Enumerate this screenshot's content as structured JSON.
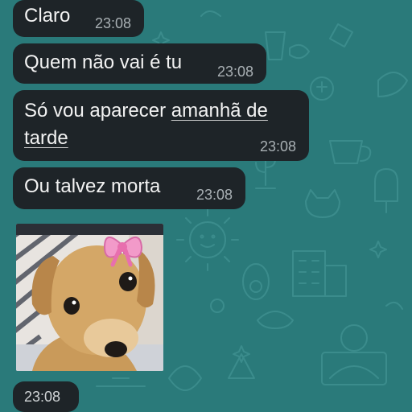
{
  "conversation": {
    "messages": [
      {
        "text": "Claro",
        "time": "23:08"
      },
      {
        "text": "Quem não vai é tu",
        "time": "23:08"
      },
      {
        "text_before_link": "Só vou aparecer ",
        "link_line1": "amanhã de",
        "link_line2": "tarde",
        "time": "23:08"
      },
      {
        "text": "Ou talvez morta",
        "time": "23:08"
      }
    ],
    "sticker": {
      "icon": "puppy-with-pink-bow-sticker",
      "time": "23:08"
    }
  },
  "colors": {
    "wallpaper": "#2a7a7a",
    "bubble": "#1e2428",
    "text": "#f2f2f2",
    "timestamp": "#a9b0b4",
    "bow": "#f29ac9"
  }
}
